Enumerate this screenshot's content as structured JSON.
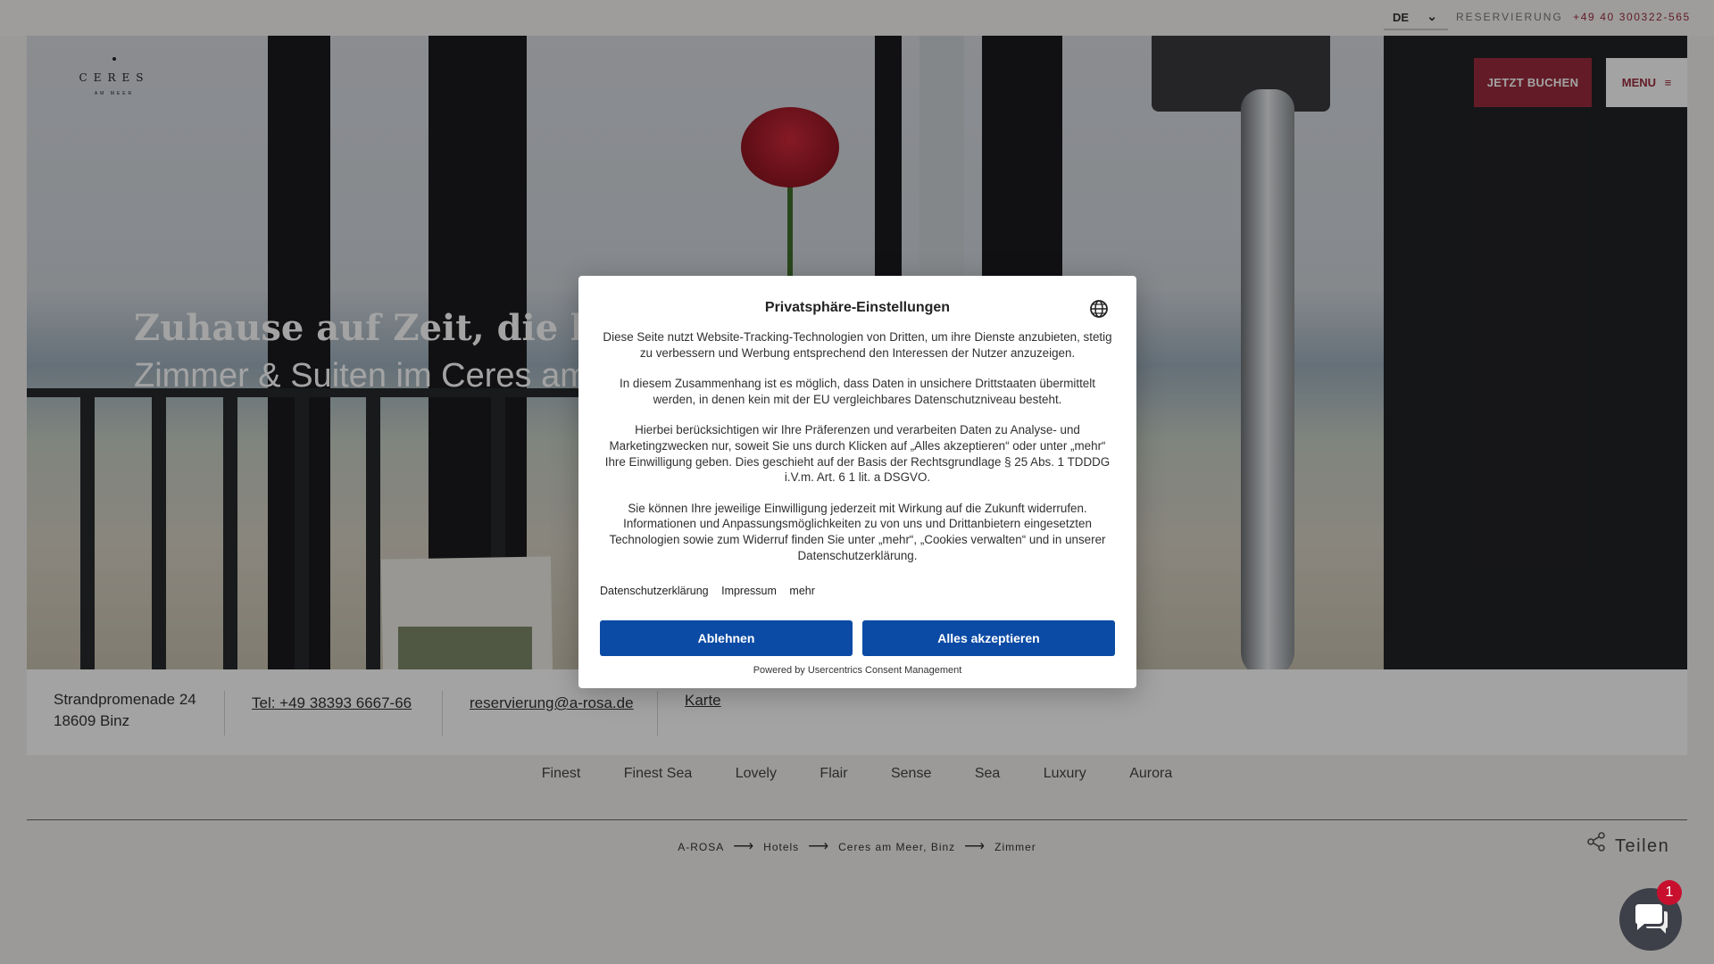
{
  "topbar": {
    "lang": "DE",
    "reservation_label": "RESERVIERUNG",
    "reservation_phone": "+49 40 300322-565"
  },
  "header": {
    "logo_text": "CERES",
    "logo_sub": "AM MEER",
    "book_label": "JETZT BUCHEN",
    "menu_label": "MENU"
  },
  "hero": {
    "title": "Zuhause auf Zeit, die begeist",
    "subtitle": "Zimmer & Suiten im Ceres am"
  },
  "contact": {
    "street": "Strandpromenade 24",
    "city": "18609 Binz",
    "phone": "Tel: +49 38393 6667-66",
    "email": "reservierung@a-rosa.de",
    "map": "Karte"
  },
  "tabs": [
    "Finest",
    "Finest Sea",
    "Lovely",
    "Flair",
    "Sense",
    "Sea",
    "Luxury",
    "Aurora"
  ],
  "breadcrumb": [
    "A-ROSA",
    "Hotels",
    "Ceres am Meer, Binz",
    "Zimmer"
  ],
  "share_label": "Teilen",
  "chat": {
    "badge": "1"
  },
  "consent": {
    "title": "Privatsphäre-Einstellungen",
    "paragraphs": [
      "Diese Seite nutzt Website-Tracking-Technologien von Dritten, um ihre Dienste anzubieten, stetig zu verbessern und Werbung entsprechend den Interessen der Nutzer anzuzeigen.",
      "In diesem Zusammenhang ist es möglich, dass Daten in unsichere Drittstaaten übermittelt werden, in denen kein mit der EU vergleichbares Datenschutzniveau besteht.",
      "Hierbei berücksichtigen wir Ihre Präferenzen und verarbeiten Daten zu Analyse- und Marketingzwecken nur, soweit Sie uns durch Klicken auf „Alles akzeptieren“ oder unter „mehr“ Ihre Einwilligung geben. Dies geschieht auf der Basis der Rechtsgrundlage § 25 Abs. 1 TDDDG i.V.m. Art. 6 1 lit. a DSGVO.",
      "Sie können Ihre jeweilige Einwilligung jederzeit mit Wirkung auf die Zukunft widerrufen. Informationen und Anpassungsmöglichkeiten zu von uns und Drittanbietern eingesetzten Technologien sowie zum Widerruf finden Sie unter „mehr“, „Cookies verwalten“ und in unserer Datenschutzerklärung."
    ],
    "links": [
      "Datenschutzerklärung",
      "Impressum",
      "mehr"
    ],
    "deny_label": "Ablehnen",
    "accept_label": "Alles akzeptieren",
    "powered_by": "Powered by Usercentrics Consent Management"
  }
}
